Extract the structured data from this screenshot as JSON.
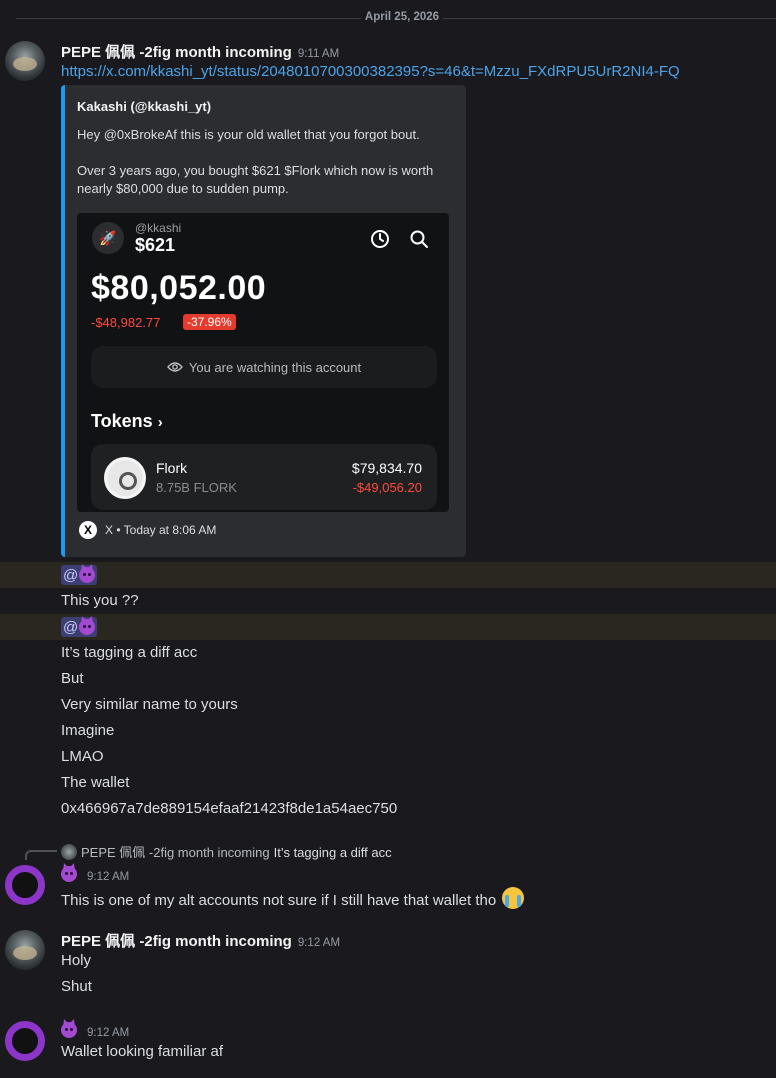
{
  "date_divider": "April 25, 2026",
  "messages": [
    {
      "author": "PEPE 佩佩 -2fig month incoming",
      "time": "9:11 AM",
      "link": "https://x.com/kkashi_yt/status/2048010700300382395?s=46&t=Mzzu_FXdRPU5UrR2NI4-FQ",
      "embed": {
        "author": "Kakashi (@kkashi_yt)",
        "desc1": "Hey @0xBrokeAf this is your old wallet that you forgot bout.",
        "desc2": "Over 3 years ago, you bought $621 $Flork which now is worth nearly $80,000 due to sudden pump.",
        "wallet": {
          "handle": "@kkashi",
          "small_value": "$621",
          "balance": "$80,052.00",
          "delta": "-$48,982.77",
          "delta_pct": "-37.96%",
          "watching": "You are watching this account",
          "tokens_label": "Tokens",
          "token_name": "Flork",
          "token_amount": "8.75B FLORK",
          "token_value": "$79,834.70",
          "token_change": "-$49,056.20"
        },
        "footer": "X • Today at 8:06 AM",
        "footer_logo": "X"
      },
      "lines": [
        "This you ??",
        "It’s tagging a diff acc",
        "But",
        "Very similar name to yours",
        "Imagine",
        "LMAO",
        "The wallet",
        "0x466967a7de889154efaaf21423f8de1a54aec750"
      ],
      "mention": "@"
    },
    {
      "reply_author": "PEPE 佩佩 -2fig month incoming",
      "reply_text": "It’s tagging a diff acc",
      "time": "9:12 AM",
      "text": "This is one of my alt accounts not sure if I still have that wallet tho"
    },
    {
      "author": "PEPE 佩佩 -2fig month incoming",
      "time": "9:12 AM",
      "lines": [
        "Holy",
        "Shut"
      ]
    },
    {
      "time": "9:12 AM",
      "text": "Wallet looking familiar af"
    }
  ],
  "colors": {
    "background": "#1a1a1e",
    "link": "#4da3e8",
    "embed_border": "#1d9bf0",
    "negative": "#ff4a3d",
    "avatar_ring": "#8c35c9",
    "highlight": "#2a2620"
  }
}
